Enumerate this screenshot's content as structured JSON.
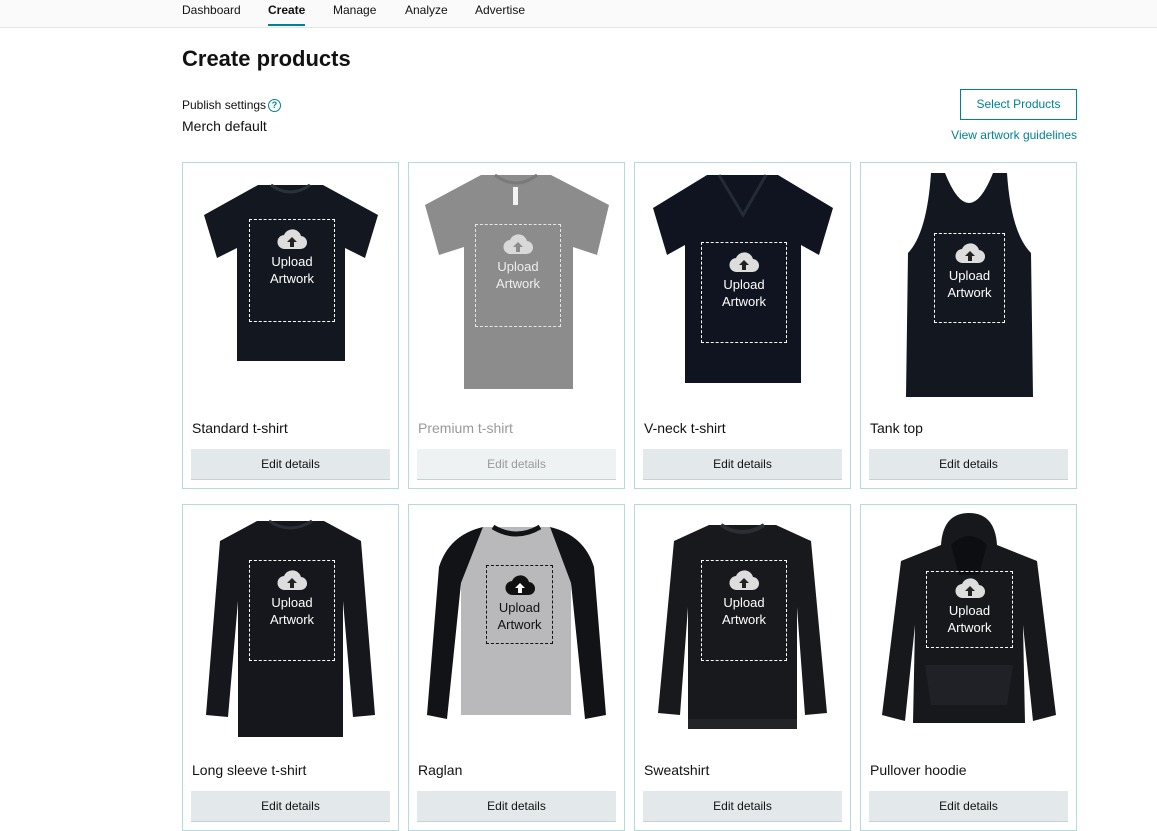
{
  "nav": {
    "tabs": [
      {
        "label": "Dashboard",
        "active": false
      },
      {
        "label": "Create",
        "active": true
      },
      {
        "label": "Manage",
        "active": false
      },
      {
        "label": "Analyze",
        "active": false
      },
      {
        "label": "Advertise",
        "active": false
      }
    ]
  },
  "page": {
    "title": "Create products",
    "publish_settings_label": "Publish settings",
    "publish_settings_value": "Merch default",
    "help_icon": "question-circle-icon",
    "select_products_label": "Select Products",
    "artwork_guidelines_link": "View artwork guidelines"
  },
  "colors": {
    "accent": "#008296",
    "card_border": "#b7d8dc",
    "button_bg": "#e3e9ea"
  },
  "upload": {
    "line1": "Upload",
    "line2": "Artwork",
    "icon": "cloud-upload-icon"
  },
  "products": [
    {
      "name": "Standard t-shirt",
      "edit_label": "Edit details",
      "enabled": true
    },
    {
      "name": "Premium t-shirt",
      "edit_label": "Edit details",
      "enabled": false
    },
    {
      "name": "V-neck t-shirt",
      "edit_label": "Edit details",
      "enabled": true
    },
    {
      "name": "Tank top",
      "edit_label": "Edit details",
      "enabled": true
    },
    {
      "name": "Long sleeve t-shirt",
      "edit_label": "Edit details",
      "enabled": true
    },
    {
      "name": "Raglan",
      "edit_label": "Edit details",
      "enabled": true
    },
    {
      "name": "Sweatshirt",
      "edit_label": "Edit details",
      "enabled": true
    },
    {
      "name": "Pullover hoodie",
      "edit_label": "Edit details",
      "enabled": true
    }
  ]
}
